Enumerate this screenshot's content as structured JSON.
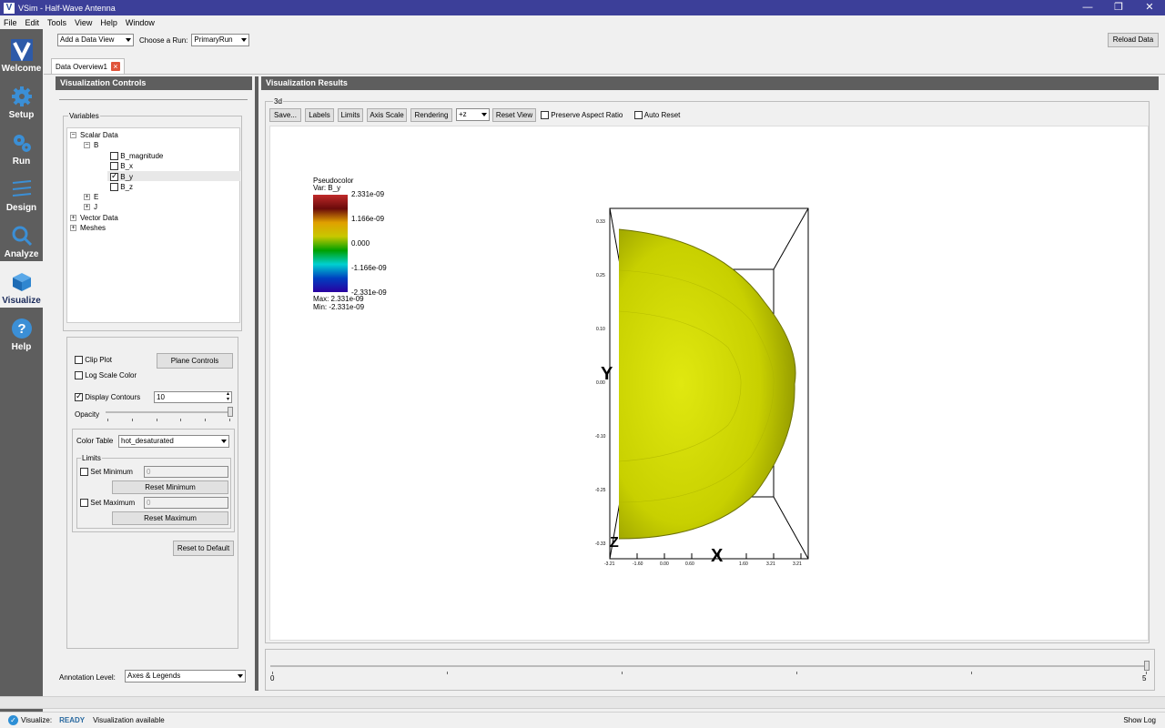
{
  "window": {
    "title": "VSim - Half-Wave Antenna",
    "controls": [
      "—",
      "❐",
      "✕"
    ]
  },
  "menu": [
    "File",
    "Edit",
    "Tools",
    "View",
    "Help",
    "Window"
  ],
  "toolbar": {
    "add_view": "Add a Data View",
    "choose_run_label": "Choose a Run:",
    "run_value": "PrimaryRun",
    "reload": "Reload Data"
  },
  "sidebar": [
    {
      "label": "Welcome",
      "icon": "vsim-logo-icon"
    },
    {
      "label": "Setup",
      "icon": "gear-icon"
    },
    {
      "label": "Run",
      "icon": "gears-icon"
    },
    {
      "label": "Design",
      "icon": "design-lines-icon"
    },
    {
      "label": "Analyze",
      "icon": "magnifier-icon"
    },
    {
      "label": "Visualize",
      "icon": "cube-icon"
    },
    {
      "label": "Help",
      "icon": "help-icon"
    }
  ],
  "tab": {
    "label": "Data Overview1"
  },
  "controls_panel": {
    "title": "Visualization Controls",
    "variables_label": "Variables",
    "tree": {
      "scalar_data": "Scalar Data",
      "b": "B",
      "b_items": [
        "B_magnitude",
        "B_x",
        "B_y",
        "B_z"
      ],
      "e": "E",
      "j": "J",
      "vector_data": "Vector Data",
      "meshes": "Meshes"
    },
    "clip_plot": "Clip Plot",
    "plane_controls": "Plane Controls",
    "log_scale": "Log Scale Color",
    "display_contours": "Display Contours",
    "contours_value": "10",
    "opacity": "Opacity",
    "color_table_label": "Color Table",
    "color_table_value": "hot_desaturated",
    "limits": "Limits",
    "set_minimum": "Set Minimum",
    "min_value": "0",
    "reset_minimum": "Reset Minimum",
    "set_maximum": "Set Maximum",
    "max_value": "0",
    "reset_maximum": "Reset Maximum",
    "reset_default": "Reset to Default",
    "annotation_label": "Annotation Level:",
    "annotation_value": "Axes & Legends"
  },
  "results_panel": {
    "title": "Visualization Results",
    "group_label": "3d",
    "buttons": [
      "Save...",
      "Labels",
      "Limits",
      "Axis Scale",
      "Rendering"
    ],
    "view_dir": "+z",
    "reset_view": "Reset View",
    "preserve_aspect": "Preserve Aspect Ratio",
    "auto_reset": "Auto Reset"
  },
  "legend": {
    "title": "Pseudocolor",
    "var": "Var: B_y",
    "ticks": [
      "2.331e-09",
      "1.166e-09",
      "0.000",
      "-1.166e-09",
      "-2.331e-09"
    ],
    "max": "Max:  2.331e-09",
    "min": "Min: -2.331e-09",
    "colors": [
      "#c02a2a",
      "#6a0a0a",
      "#e0a000",
      "#c8c800",
      "#00a000",
      "#00d0d0",
      "#0040c0",
      "#2a00a0"
    ]
  },
  "plot": {
    "axis_x": "X",
    "axis_y": "Y",
    "axis_z": "Z",
    "y_ticks": [
      "0.33",
      "0.25",
      "0.10",
      "0.00",
      "-0.10",
      "-0.25",
      "-0.33"
    ],
    "x_ticks": [
      "-3.21",
      "-1.60",
      "0.00",
      "0.60",
      "1.60",
      "3.21",
      "3.21"
    ],
    "shape_color": "#c8d000"
  },
  "timeline": {
    "start": "0",
    "end": "5"
  },
  "status": {
    "label": "Visualize:",
    "state": "READY",
    "message": "Visualization available",
    "show_log": "Show Log"
  }
}
